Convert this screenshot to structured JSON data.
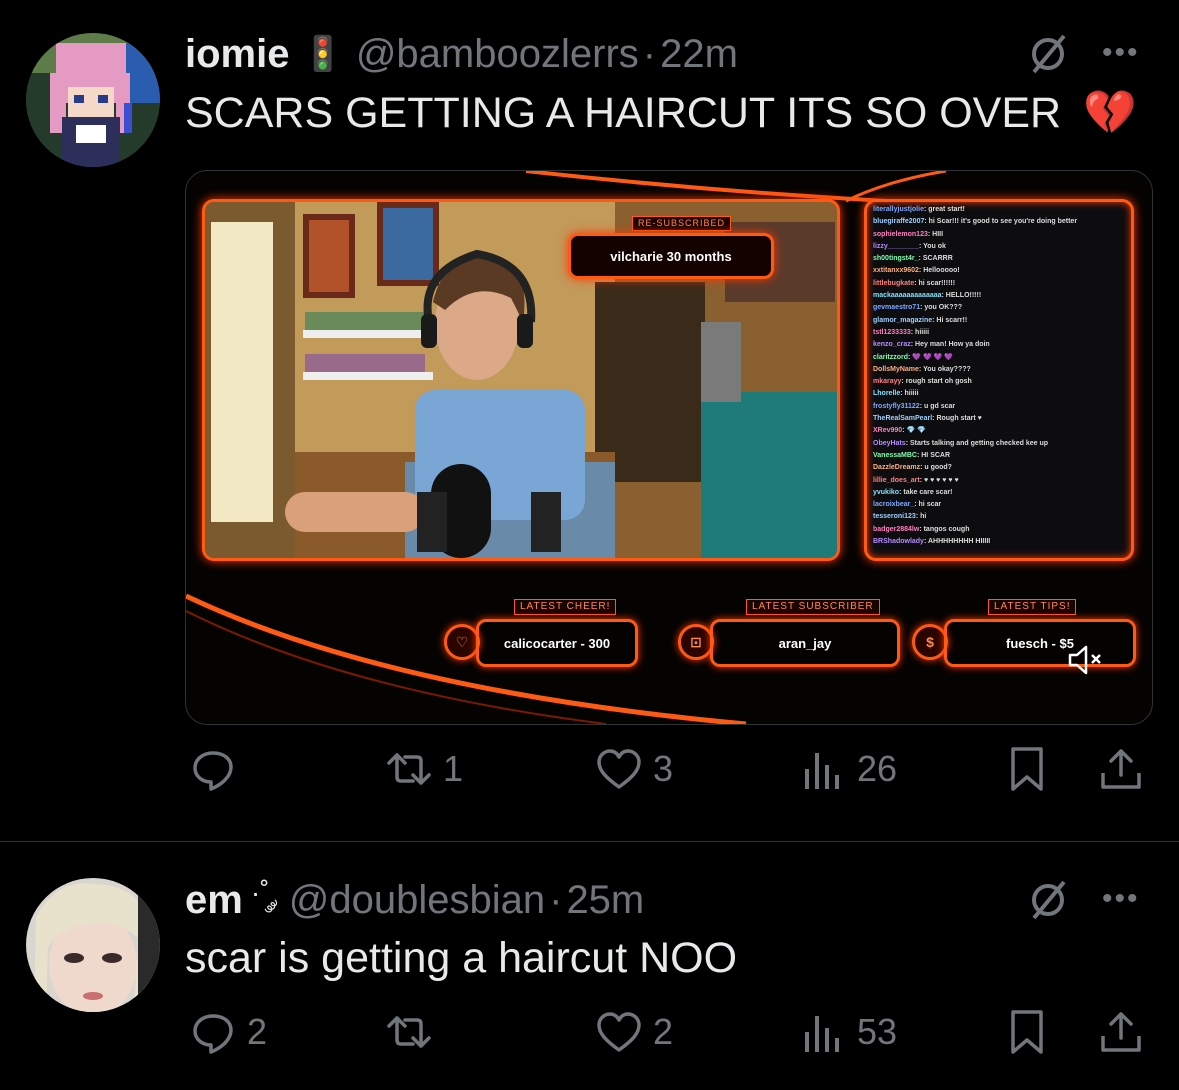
{
  "tweets": [
    {
      "author": {
        "name": "iomie",
        "emoji": "🚦",
        "handle": "@bamboozlerrs",
        "time": "22m"
      },
      "text": "SCARS GETTING A HAIRCUT ITS SO OVER",
      "text_emoji": "💔",
      "media": {
        "alert_label": "RE-SUBSCRIBED",
        "alert_text": "vilcharie 30 months",
        "chat": [
          {
            "user": "literallyjustjolie",
            "msg": "great start!"
          },
          {
            "user": "bluegiraffe2007",
            "msg": "hi Scar!!! it's good to see you're doing better"
          },
          {
            "user": "sophielemon123",
            "msg": "HIII"
          },
          {
            "user": "lizzy________",
            "msg": "You ok"
          },
          {
            "user": "sh00tingst4r_",
            "msg": "SCARRR"
          },
          {
            "user": "xxtitanxx9602",
            "msg": "Hellooooo!"
          },
          {
            "user": "littlebugkate",
            "msg": "hi scar!!!!!!"
          },
          {
            "user": "mackaaaaaaaaaaaaa",
            "msg": "HELLO!!!!!"
          },
          {
            "user": "gevmaestro71",
            "msg": "you OK???"
          },
          {
            "user": "glamor_magazine",
            "msg": "Hi scarr!!"
          },
          {
            "user": "tstl1233333",
            "msg": "hiiiii"
          },
          {
            "user": "kenzo_craz",
            "msg": "Hey man! How ya doin"
          },
          {
            "user": "claritzzord",
            "msg": "💜 💜 💜 💜"
          },
          {
            "user": "DollsMyName",
            "msg": "You okay????"
          },
          {
            "user": "mkarayy",
            "msg": "rough start oh gosh"
          },
          {
            "user": "Lhorelle",
            "msg": "hiiiii"
          },
          {
            "user": "frostyfly31122",
            "msg": "u gd scar"
          },
          {
            "user": "TheRealSamPearl",
            "msg": "Rough start ♥"
          },
          {
            "user": "XRev990",
            "msg": "💎 💎"
          },
          {
            "user": "ObeyHats",
            "msg": "Starts talking and getting checked kee up"
          },
          {
            "user": "VanessaMBC",
            "msg": "HI SCAR"
          },
          {
            "user": "DazzleDreamz",
            "msg": "u good?"
          },
          {
            "user": "lillie_does_art",
            "msg": "♥ ♥ ♥ ♥ ♥ ♥"
          },
          {
            "user": "yvukiko",
            "msg": "take care scar!"
          },
          {
            "user": "lacroixbear_",
            "msg": "hi scar"
          },
          {
            "user": "tesseroni123",
            "msg": "hi"
          },
          {
            "user": "badger2884lw",
            "msg": "tangos cough"
          },
          {
            "user": "BRShadowlady",
            "msg": "AHHHHHHHH HIIIII"
          }
        ],
        "cheer_label": "LATEST CHEER!",
        "cheer_value": "calicocarter - 300",
        "sub_label": "LATEST SUBSCRIBER",
        "sub_value": "aran_jay",
        "tips_label": "LATEST TIPS!",
        "tips_value": "fuesch - $5",
        "coin_symbols": {
          "cheer": "♡",
          "sub": "⊡",
          "tips": "$"
        }
      },
      "stats": {
        "replies": "",
        "reposts": "1",
        "likes": "3",
        "views": "26"
      }
    },
    {
      "author": {
        "name": "em",
        "emoji": "·˚ ༘",
        "handle": "@doublesbian",
        "time": "25m"
      },
      "text": "scar is getting a haircut NOO",
      "stats": {
        "replies": "2",
        "reposts": "",
        "likes": "2",
        "views": "53"
      }
    }
  ],
  "icons": [
    "grok-icon",
    "more-icon",
    "reply-icon",
    "repost-icon",
    "like-icon",
    "views-icon",
    "bookmark-icon",
    "share-icon",
    "mute-icon"
  ],
  "colors": {
    "background": "#000000",
    "text": "#e7e9ea",
    "muted": "#71767b",
    "overlay_accent": "#ff5a14"
  }
}
